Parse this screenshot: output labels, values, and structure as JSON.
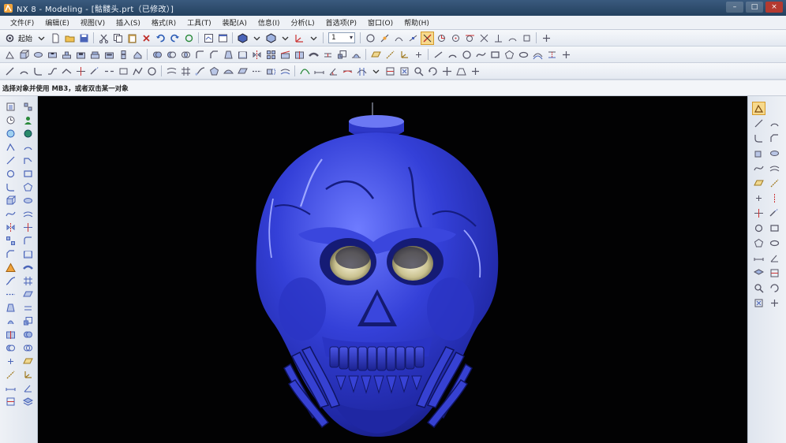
{
  "window": {
    "title": "NX 8 - Modeling - [骷髅头.prt（已修改）]",
    "controls": [
      "–",
      "□",
      "×"
    ]
  },
  "menu": {
    "items": [
      "文件(F)",
      "编辑(E)",
      "视图(V)",
      "插入(S)",
      "格式(R)",
      "工具(T)",
      "装配(A)",
      "信息(I)",
      "分析(L)",
      "首选项(P)",
      "窗口(O)",
      "帮助(H)"
    ]
  },
  "toolbar1": {
    "start_label": "起始",
    "layer_value": "1"
  },
  "prompt": {
    "text": "选择对象并使用 MB3，或者双击某一对象"
  },
  "viewport": {
    "background": "#020203",
    "model_color": "#2f38c9",
    "model_name": "skull-model"
  },
  "colors": {
    "accent": "#f7d98c",
    "titlebar": "#2d4a6c"
  }
}
